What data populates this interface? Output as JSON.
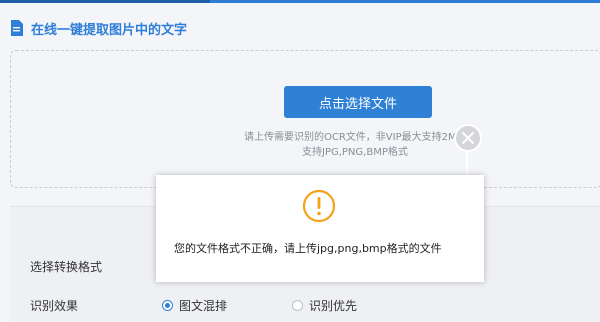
{
  "header": {
    "title": "在线一键提取图片中的文字"
  },
  "upload": {
    "button_label": "点击选择文件",
    "hint_line1": "请上传需要识别的OCR文件，非VIP最大支持2M",
    "hint_line2": "支持JPG,PNG,BMP格式"
  },
  "settings": {
    "format_label": "选择转换格式",
    "effect_label": "识别效果",
    "options": [
      {
        "label": "图文混排",
        "checked": true
      },
      {
        "label": "识别优先",
        "checked": false
      }
    ]
  },
  "dialog": {
    "message": "您的文件格式不正确，请上传jpg,png,bmp格式的文件"
  },
  "colors": {
    "accent": "#2f81d6",
    "warning": "#f4a11b"
  },
  "icons": {
    "title": "document-icon",
    "close": "close-icon",
    "warning": "warning-icon"
  }
}
